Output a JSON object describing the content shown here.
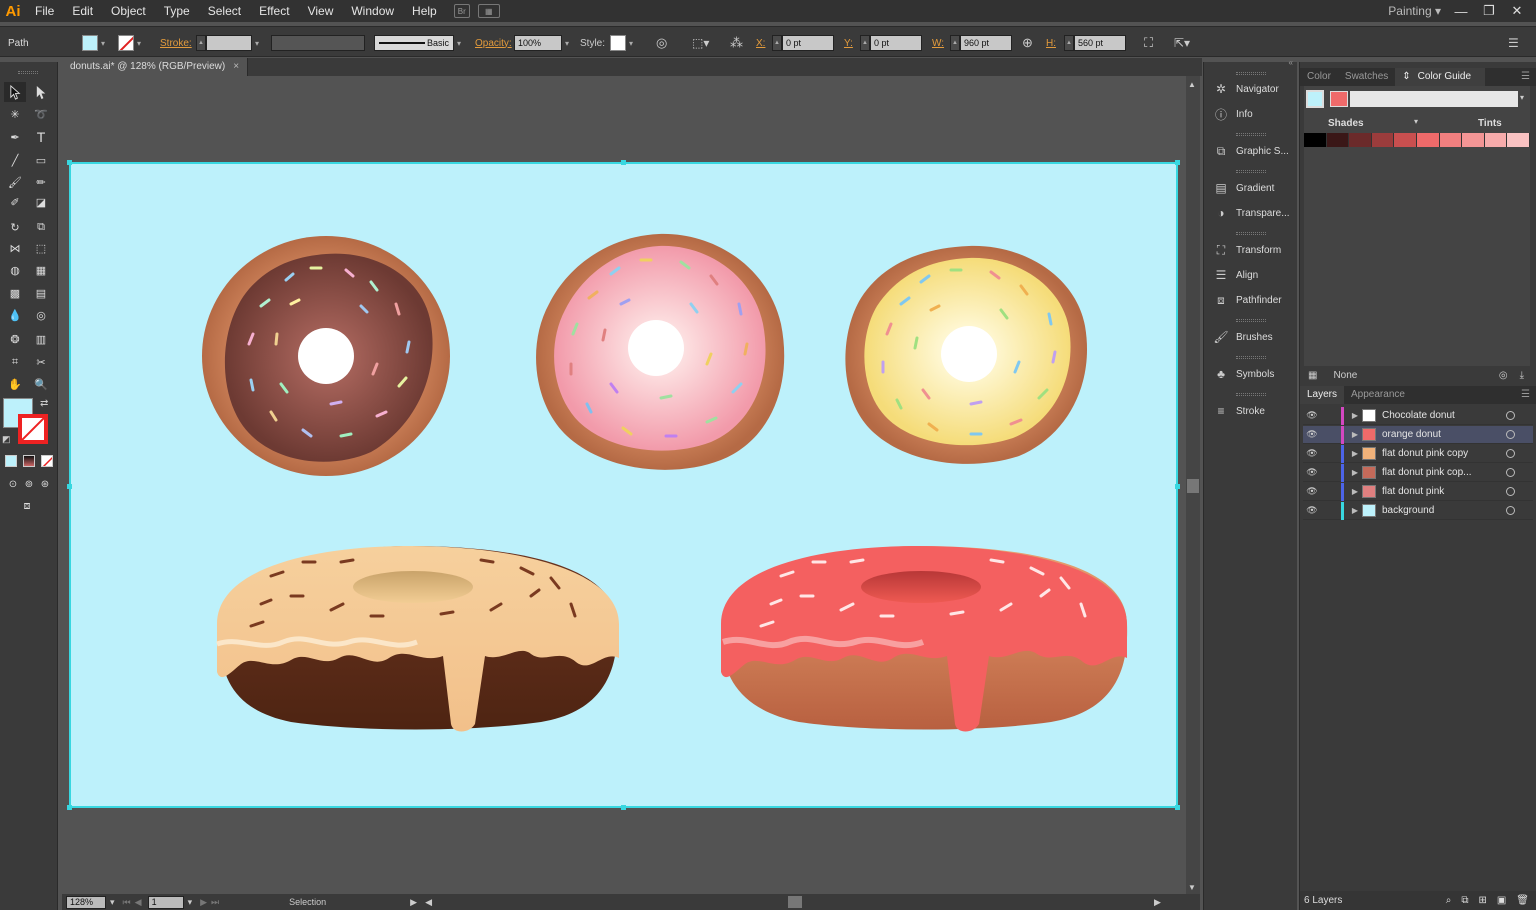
{
  "app": {
    "logo": "Ai",
    "workspace": "Painting",
    "win_controls": [
      "—",
      "❐",
      "✕"
    ]
  },
  "menu": [
    "File",
    "Edit",
    "Object",
    "Type",
    "Select",
    "Effect",
    "View",
    "Window",
    "Help"
  ],
  "menubar_buttons": [
    "Br",
    "▦"
  ],
  "control": {
    "selection_type": "Path",
    "fill_color": "#bdf1fb",
    "stroke_label": "Stroke:",
    "brush": "Basic",
    "opacity_label": "Opacity:",
    "opacity": "100%",
    "style_label": "Style:",
    "x_label": "X:",
    "x": "0 pt",
    "y_label": "Y:",
    "y": "0 pt",
    "w_label": "W:",
    "w": "960 pt",
    "h_label": "H:",
    "h": "560 pt"
  },
  "document": {
    "tab": "donuts.ai* @ 128% (RGB/Preview)",
    "close": "×"
  },
  "artboard": {
    "color": "#bdf1fb"
  },
  "status": {
    "zoom": "128%",
    "artboard_num": "1",
    "tool": "Selection"
  },
  "dock": [
    "Navigator",
    "Info",
    "Graphic S...",
    "Gradient",
    "Transpare...",
    "Transform",
    "Align",
    "Pathfinder",
    "Brushes",
    "Symbols",
    "Stroke"
  ],
  "color_panel": {
    "tabs": [
      "Color",
      "Swatches",
      "Color Guide"
    ],
    "shades_label": "Shades",
    "tints_label": "Tints",
    "base_color": "#ef6a6a",
    "swatches": [
      "#000000",
      "#3a1717",
      "#6b2a2a",
      "#9b3c3c",
      "#c94f4f",
      "#ef6a6a",
      "#f27f7f",
      "#f49595",
      "#f7abab",
      "#f9c2c2"
    ],
    "none_label": "None"
  },
  "layers_panel": {
    "tabs": [
      "Layers",
      "Appearance"
    ],
    "layers": [
      {
        "name": "Chocolate donut",
        "color": "#d447c1",
        "thumb": "#ffffff",
        "selected": false
      },
      {
        "name": "orange donut",
        "color": "#d447c1",
        "thumb": "#ef6a6a",
        "selected": true
      },
      {
        "name": "flat donut pink copy",
        "color": "#4c64e8",
        "thumb": "#f0b27a",
        "selected": false
      },
      {
        "name": "flat donut pink cop...",
        "color": "#4c64e8",
        "thumb": "#c46a5a",
        "selected": false
      },
      {
        "name": "flat donut pink",
        "color": "#4c64e8",
        "thumb": "#e08080",
        "selected": false
      },
      {
        "name": "background",
        "color": "#38d7e0",
        "thumb": "#bdf1fb",
        "selected": false
      }
    ],
    "count": "6 Layers"
  }
}
